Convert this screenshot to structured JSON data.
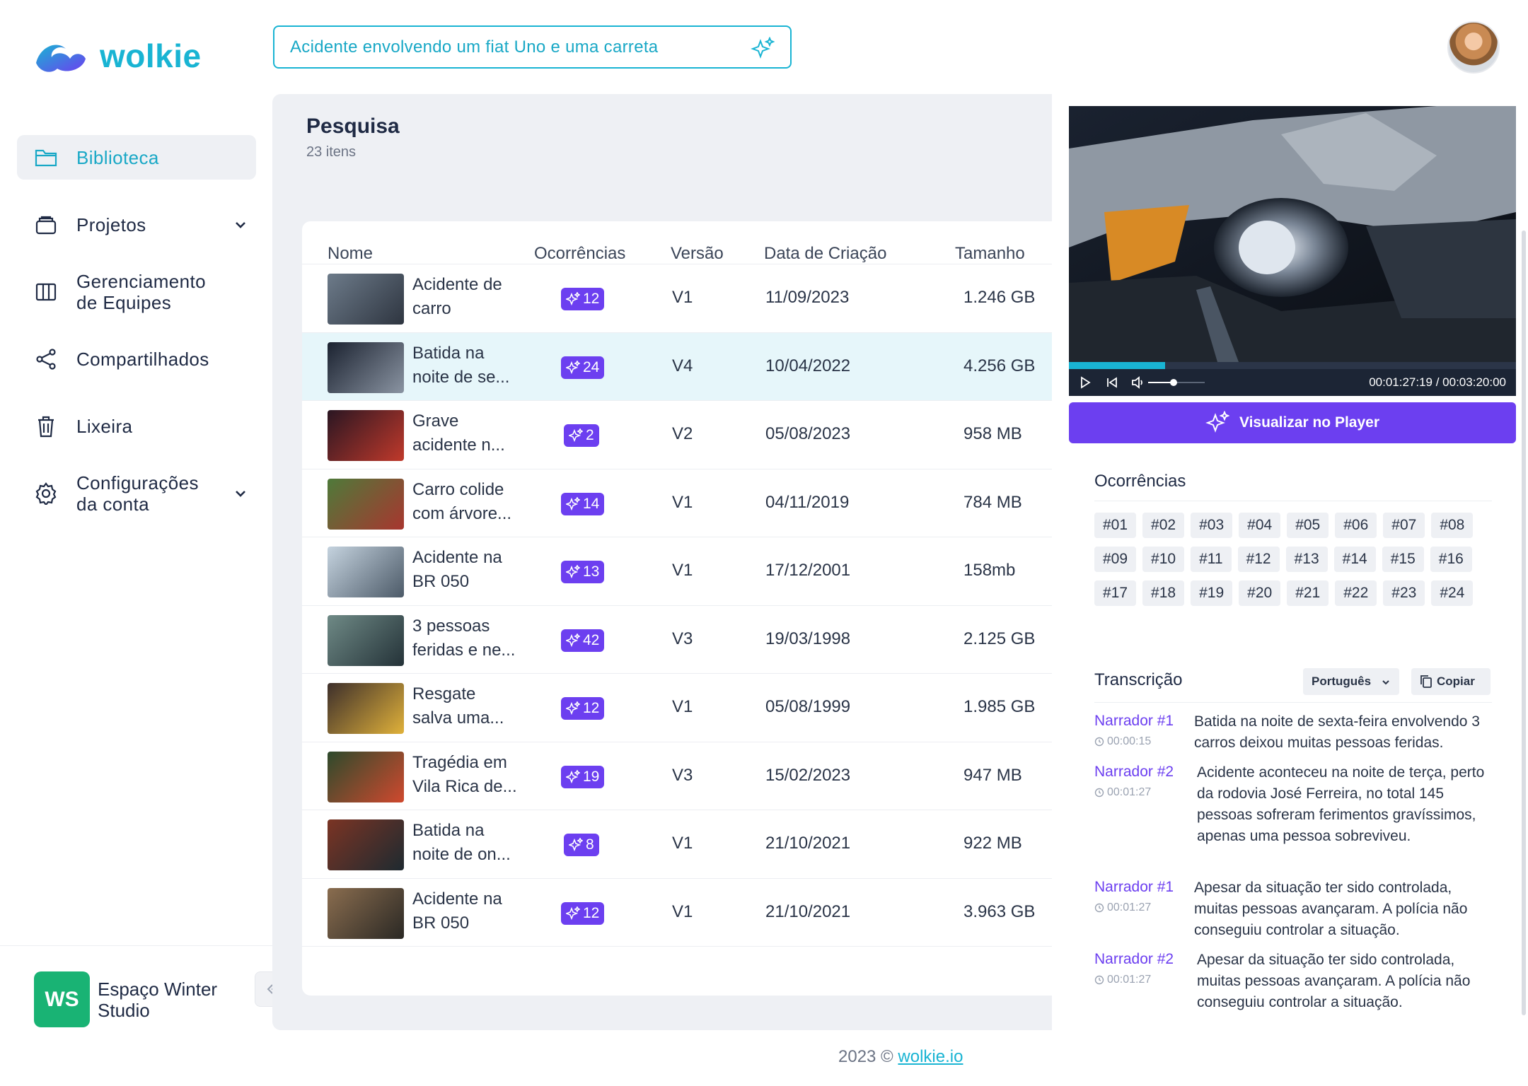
{
  "brand": {
    "name": "wolkie",
    "accent": "#19b4d3",
    "primary": "#6c3ff0"
  },
  "search": {
    "value": "Acidente envolvendo um fiat Uno e uma carreta"
  },
  "sidebar": {
    "items": [
      {
        "label": "Biblioteca",
        "icon": "folder-icon"
      },
      {
        "label": "Projetos",
        "icon": "briefcase-icon"
      },
      {
        "label": "Gerenciamento de Equipes",
        "icon": "columns-icon"
      },
      {
        "label": "Compartilhados",
        "icon": "share-icon"
      },
      {
        "label": "Lixeira",
        "icon": "trash-icon"
      },
      {
        "label": "Configurações da conta",
        "icon": "gear-icon"
      }
    ],
    "workspace": {
      "initials": "WS",
      "name": "Espaço Winter Studio"
    }
  },
  "page": {
    "title": "Pesquisa",
    "subtitle": "23 itens"
  },
  "table": {
    "headers": [
      "Nome",
      "Ocorrências",
      "Versão",
      "Data de Criação",
      "Tamanho"
    ],
    "rows": [
      {
        "name": "Acidente de carro",
        "count": "12",
        "version": "V1",
        "date": "11/09/2023",
        "size": "1.246 GB"
      },
      {
        "name": "Batida na noite de se...",
        "count": "24",
        "version": "V4",
        "date": "10/04/2022",
        "size": "4.256 GB"
      },
      {
        "name": "Grave acidente n...",
        "count": "2",
        "version": "V2",
        "date": "05/08/2023",
        "size": "958 MB"
      },
      {
        "name": "Carro colide com árvore...",
        "count": "14",
        "version": "V1",
        "date": "04/11/2019",
        "size": "784 MB"
      },
      {
        "name": "Acidente na BR 050",
        "count": "13",
        "version": "V1",
        "date": "17/12/2001",
        "size": "158mb"
      },
      {
        "name": "3 pessoas feridas e ne...",
        "count": "42",
        "version": "V3",
        "date": "19/03/1998",
        "size": "2.125 GB"
      },
      {
        "name": "Resgate salva uma...",
        "count": "12",
        "version": "V1",
        "date": "05/08/1999",
        "size": "1.985 GB"
      },
      {
        "name": "Tragédia em Vila Rica de...",
        "count": "19",
        "version": "V3",
        "date": "15/02/2023",
        "size": "947 MB"
      },
      {
        "name": "Batida na noite de on...",
        "count": "8",
        "version": "V1",
        "date": "21/10/2021",
        "size": "922 MB"
      },
      {
        "name": "Acidente na BR 050",
        "count": "12",
        "version": "V1",
        "date": "21/10/2021",
        "size": "3.963 GB"
      }
    ]
  },
  "player": {
    "time": "00:01:27:19 / 00:03:20:00",
    "progress": 0.215,
    "volume": 0.45,
    "view_button": "Visualizar no Player"
  },
  "occurrences": {
    "title": "Ocorrências",
    "tags": [
      "#01",
      "#02",
      "#03",
      "#04",
      "#05",
      "#06",
      "#07",
      "#08",
      "#09",
      "#10",
      "#11",
      "#12",
      "#13",
      "#14",
      "#15",
      "#16",
      "#17",
      "#18",
      "#19",
      "#20",
      "#21",
      "#22",
      "#23",
      "#24"
    ]
  },
  "transcription": {
    "title": "Transcrição",
    "language": "Português",
    "copy_label": "Copiar",
    "entries": [
      {
        "speaker": "Narrador #1",
        "time": "00:00:15",
        "text": "Batida na noite de sexta-feira envolvendo 3 carros deixou muitas pessoas feridas."
      },
      {
        "speaker": "Narrador #2",
        "time": "00:01:27",
        "text": "Acidente aconteceu na noite de terça, perto da rodovia José Ferreira, no total 145 pessoas sofreram ferimentos gravíssimos, apenas uma pessoa sobreviveu."
      },
      {
        "speaker": "Narrador #1",
        "time": "00:01:27",
        "text": "Apesar da situação ter sido controlada, muitas pessoas avançaram. A polícia não conseguiu controlar a situação."
      },
      {
        "speaker": "Narrador #2",
        "time": "00:01:27",
        "text": "Apesar da situação ter sido controlada, muitas pessoas avançaram. A polícia não conseguiu controlar a situação."
      }
    ]
  },
  "footer": {
    "prefix": "2023 ©",
    "link": "wolkie.io"
  }
}
